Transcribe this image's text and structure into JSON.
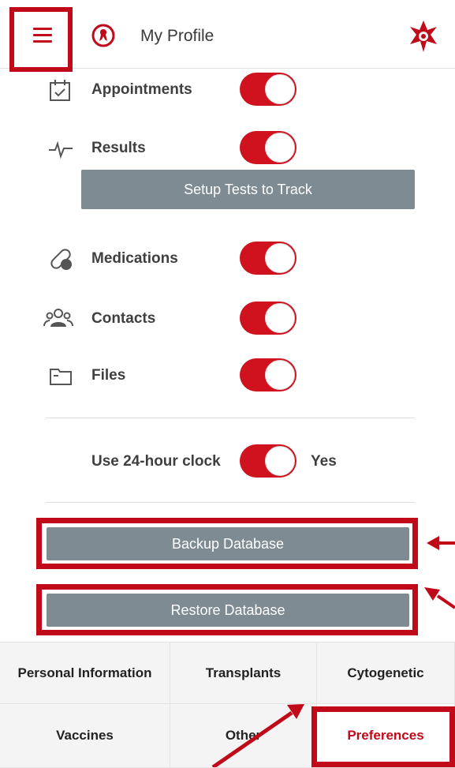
{
  "header": {
    "title": "My Profile",
    "menu_icon": "hamburger-menu-icon",
    "profile_icon": "profile-ribbon-icon",
    "logo": "flower-logo"
  },
  "settings": [
    {
      "label": "Appointments",
      "icon": "calendar-check-icon",
      "enabled": true
    },
    {
      "label": "Results",
      "icon": "pulse-icon",
      "enabled": true
    },
    {
      "label": "Medications",
      "icon": "pill-icon",
      "enabled": true
    },
    {
      "label": "Contacts",
      "icon": "people-icon",
      "enabled": true
    },
    {
      "label": "Files",
      "icon": "folder-icon",
      "enabled": true
    }
  ],
  "setup_tests_label": "Setup Tests to Track",
  "clock": {
    "label": "Use 24-hour clock",
    "value_label": "Yes",
    "enabled": true
  },
  "backup_label": "Backup Database",
  "restore_label": "Restore Database",
  "tabs": [
    {
      "label": "Personal Information"
    },
    {
      "label": "Transplants"
    },
    {
      "label": "Cytogenetic"
    },
    {
      "label": "Vaccines"
    },
    {
      "label": "Other"
    },
    {
      "label": "Preferences",
      "active": true
    }
  ],
  "colors": {
    "accent": "#c00a1a",
    "toggle_on": "#d0121f",
    "button_gray": "#7f8b92"
  }
}
